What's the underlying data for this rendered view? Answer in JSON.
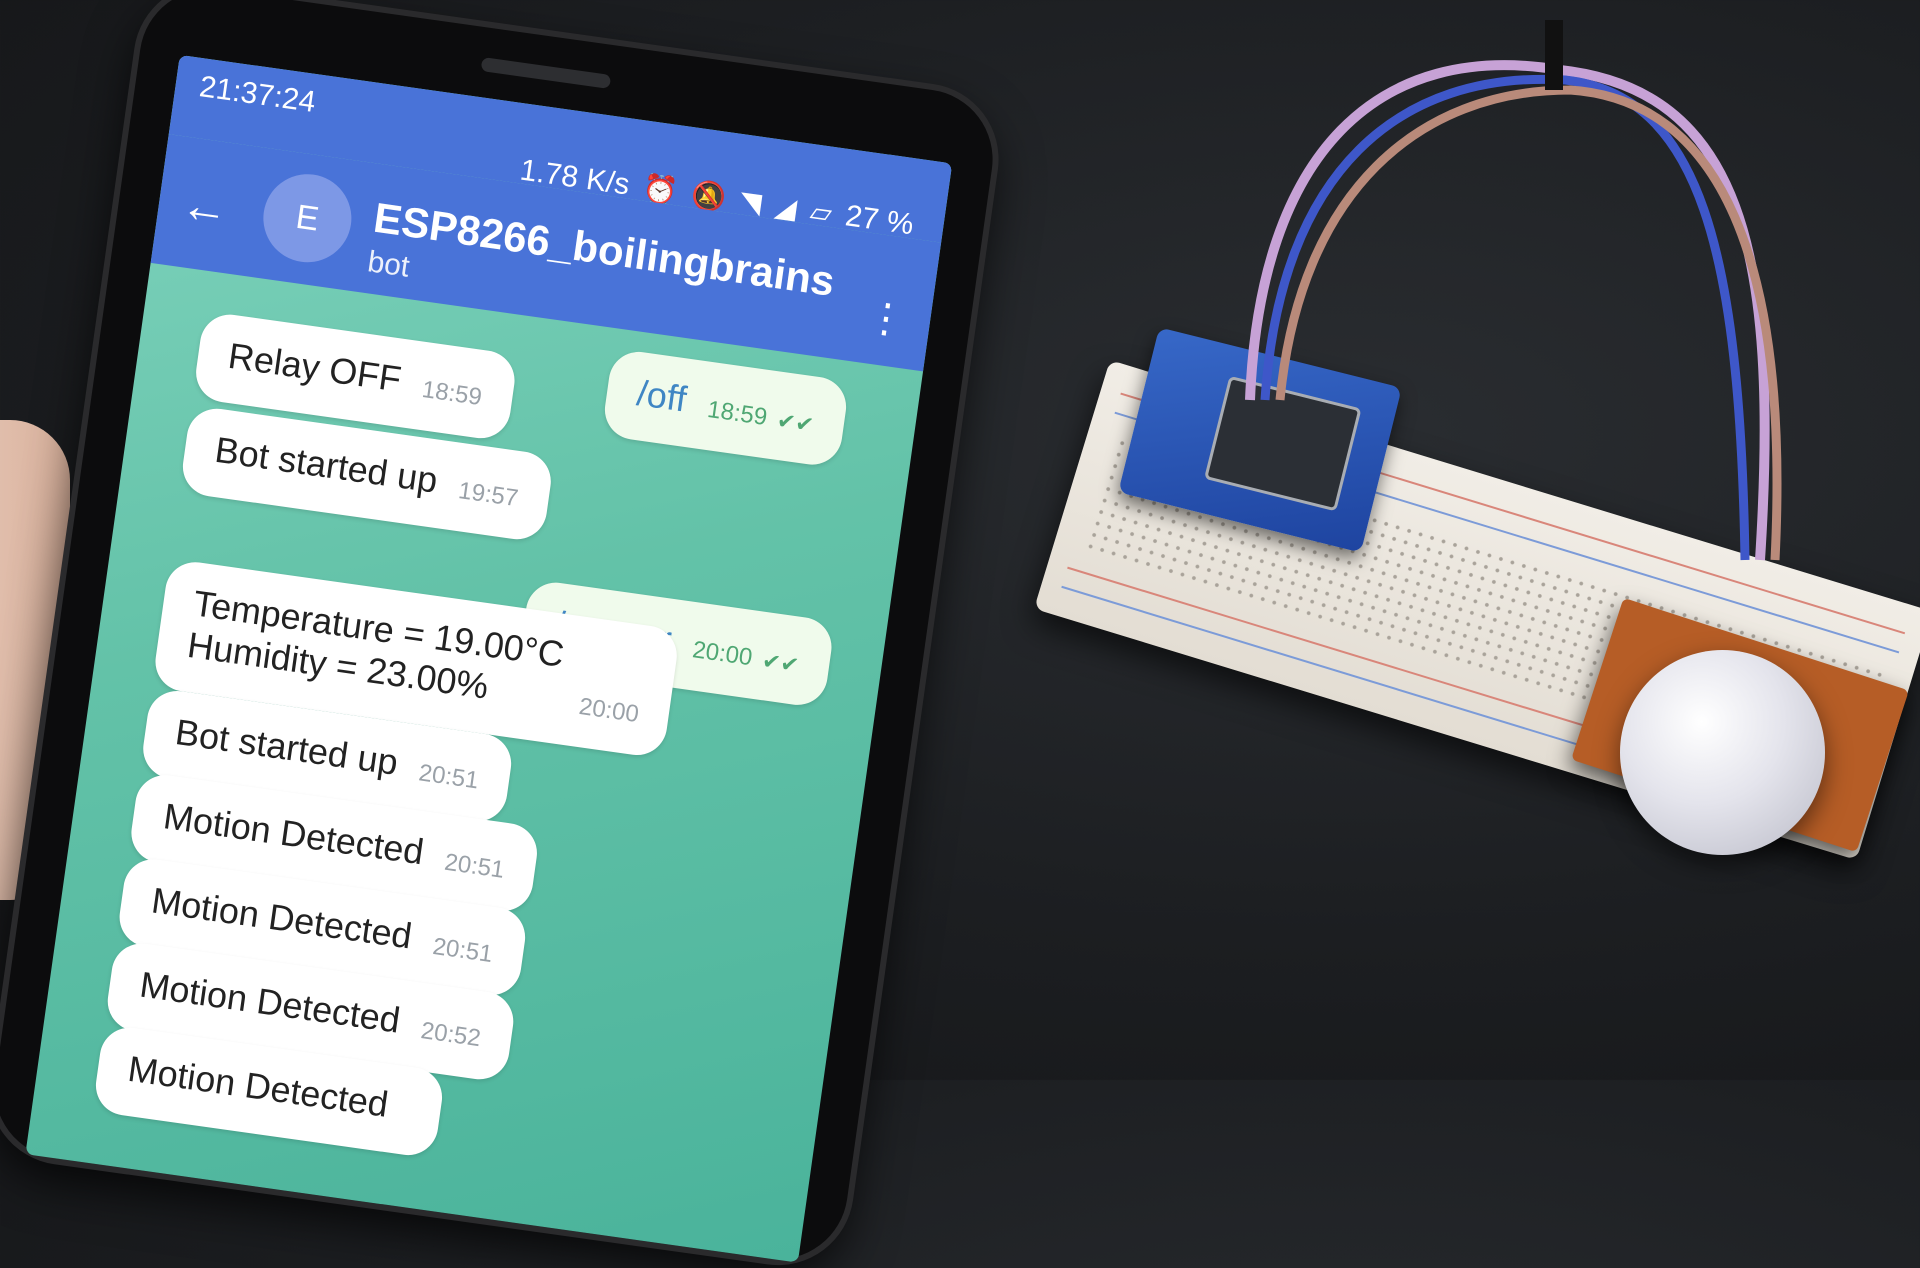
{
  "status_bar": {
    "time": "21:37:24",
    "network_speed": "1.78 K/s",
    "battery": "27 %",
    "icons": [
      "alarm-icon",
      "mute-icon",
      "wifi-icon",
      "signal-icon",
      "no-sim-icon"
    ]
  },
  "chat": {
    "back_icon": "arrow-left",
    "avatar_letter": "E",
    "title": "ESP8266_boilingbrains",
    "subtitle": "bot",
    "menu_icon": "kebab-menu"
  },
  "messages": [
    {
      "direction": "in",
      "text": "Relay OFF",
      "time": "18:59"
    },
    {
      "direction": "out",
      "text": "/off",
      "time": "18:59",
      "read": true
    },
    {
      "direction": "in",
      "text": "Bot started up",
      "time": "19:57"
    },
    {
      "direction": "out",
      "text": "/sensor",
      "time": "20:00",
      "read": true
    },
    {
      "direction": "in",
      "text": "Temperature = 19.00°C\nHumidity = 23.00%",
      "time": "20:00"
    },
    {
      "direction": "in",
      "text": "Bot started up",
      "time": "20:51"
    },
    {
      "direction": "in",
      "text": "Motion Detected",
      "time": "20:51"
    },
    {
      "direction": "in",
      "text": "Motion Detected",
      "time": "20:51"
    },
    {
      "direction": "in",
      "text": "Motion Detected",
      "time": "20:52"
    },
    {
      "direction": "in",
      "text": "Motion Detected",
      "time": ""
    }
  ],
  "colors": {
    "header_blue": "#4973d8",
    "chat_bg": "#63c2a8",
    "incoming_bubble": "#ffffff",
    "outgoing_bubble": "#f0fbec",
    "outgoing_text": "#3f86c4",
    "check_green": "#4fa773"
  }
}
